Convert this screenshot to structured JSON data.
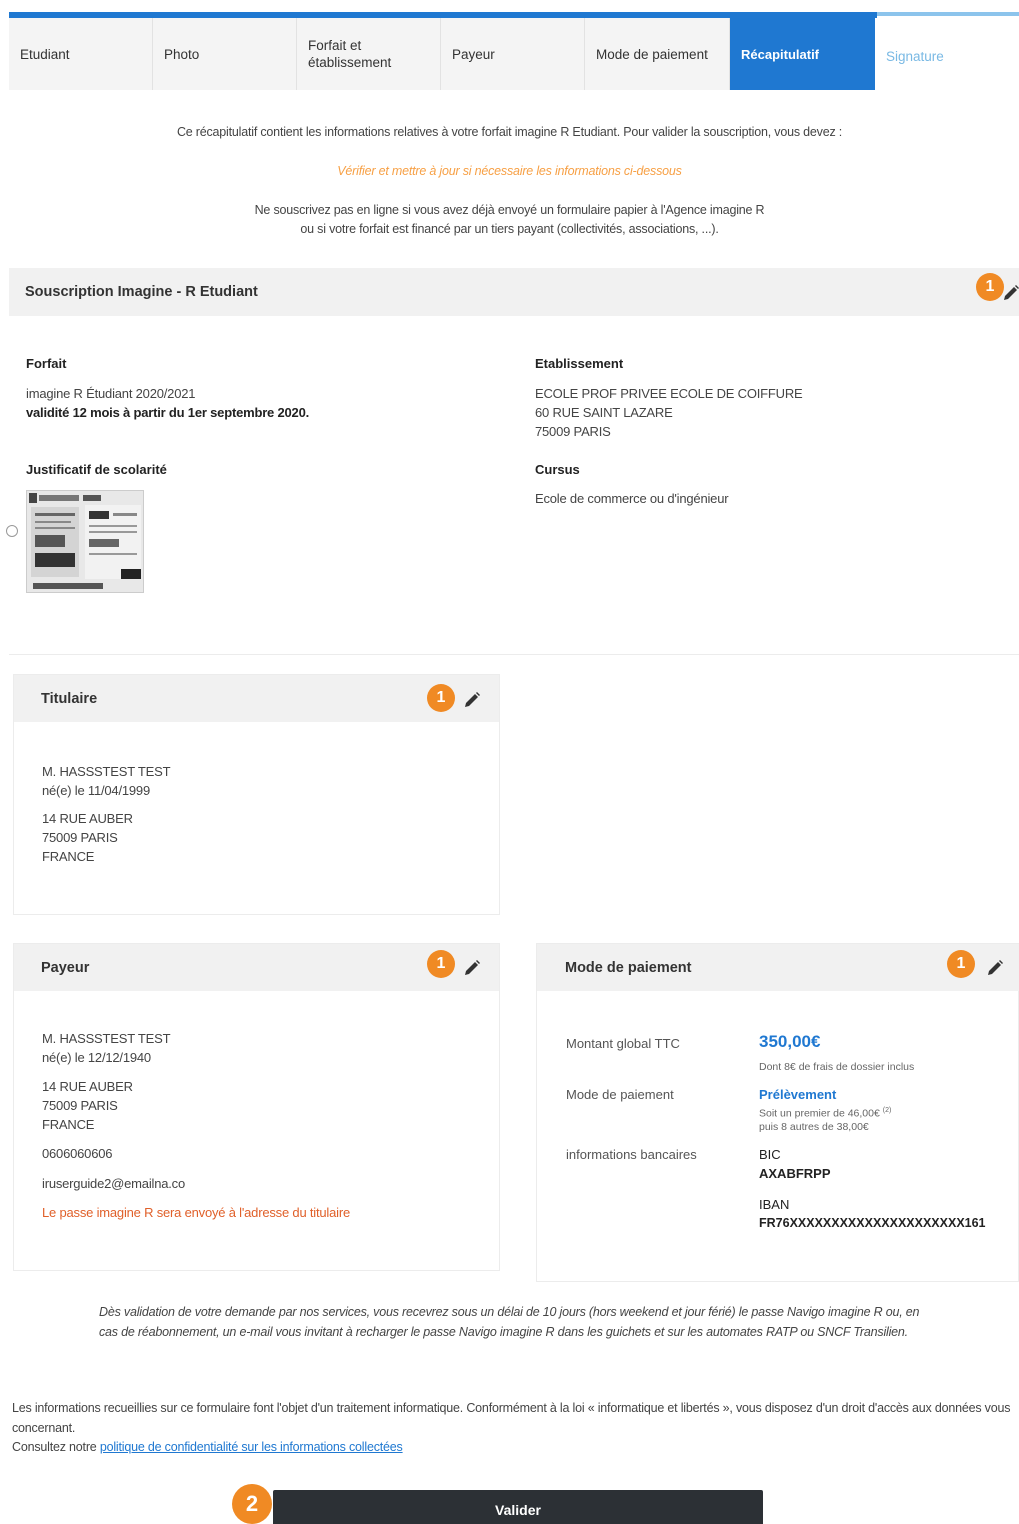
{
  "tabs": [
    {
      "label": "Etudiant"
    },
    {
      "label": "Photo"
    },
    {
      "label": "Forfait et établissement"
    },
    {
      "label": "Payeur"
    },
    {
      "label": "Mode de paiement"
    },
    {
      "label": "Récapitulatif"
    },
    {
      "label": "Signature"
    }
  ],
  "intro": {
    "line1": "Ce récapitulatif contient les informations relatives à votre forfait imagine R Etudiant. Pour valider la souscription, vous devez :",
    "line2": "Vérifier et mettre à jour si nécessaire les informations ci-dessous",
    "line3": "Ne souscrivez pas en ligne si vous avez déjà envoyé un formulaire papier à l'Agence imagine R",
    "line4": "ou si votre forfait est financé par un tiers payant  (collectivités, associations, ...)."
  },
  "subscription": {
    "title": "Souscription Imagine - R Etudiant",
    "badge": "1",
    "forfait_label": "Forfait",
    "forfait_name": "imagine R Étudiant 2020/2021",
    "forfait_validity": "validité 12 mois à partir du 1er septembre 2020.",
    "justif_label": "Justificatif de scolarité",
    "etab_label": "Etablissement",
    "etab_name": "ECOLE PROF PRIVEE ECOLE DE COIFFURE",
    "etab_street": "60 RUE SAINT LAZARE",
    "etab_city": "75009 PARIS",
    "cursus_label": "Cursus",
    "cursus_value": "Ecole de commerce ou d'ingénieur"
  },
  "titulaire": {
    "title": "Titulaire",
    "badge": "1",
    "name": "M. HASSSTEST TEST",
    "birth": "né(e) le 11/04/1999",
    "street": "14 RUE AUBER",
    "city": "75009 PARIS",
    "country": "FRANCE"
  },
  "payeur": {
    "title": "Payeur",
    "badge": "1",
    "name": "M. HASSSTEST TEST",
    "birth": "né(e) le 12/12/1940",
    "street": "14 RUE AUBER",
    "city": "75009 PARIS",
    "country": "FRANCE",
    "phone": "0606060606",
    "email": "iruserguide2@emailna.co",
    "note": "Le passe imagine R sera envoyé à l'adresse du titulaire"
  },
  "paiement": {
    "title": "Mode de paiement",
    "badge": "1",
    "montant_label": "Montant global TTC",
    "montant_value": "350,00€",
    "montant_note": "Dont 8€ de frais de dossier inclus",
    "mode_label": "Mode de paiement",
    "mode_value": "Prélèvement",
    "mode_note1": "Soit un premier de 46,00€",
    "mode_note_sup": "(2)",
    "mode_note2": "puis 8 autres de 38,00€",
    "bank_label": "informations bancaires",
    "bic_label": "BIC",
    "bic_value": "AXABFRPP",
    "iban_label": "IBAN",
    "iban_value": "FR76XXXXXXXXXXXXXXXXXXXXX161"
  },
  "notice": "Dès validation de votre demande par nos services, vous recevrez sous un délai de 10 jours (hors weekend et jour férié) le passe Navigo imagine R ou, en cas de réabonnement, un e-mail vous invitant à recharger le passe Navigo imagine R dans les guichets et sur les automates RATP ou SNCF Transilien.",
  "legal": {
    "text": "Les informations recueillies sur ce formulaire font l'objet d'un traitement informatique. Conformément à la loi « informatique et libertés », vous disposez d'un droit d'accès aux données vous concernant.",
    "consult": "Consultez notre ",
    "link": "politique de confidentialité sur les informations collectées"
  },
  "validate": {
    "badge": "2",
    "label": "Valider"
  },
  "colors": {
    "accent": "#1f78d1",
    "badge": "#f08a24",
    "button": "#2c3035"
  }
}
